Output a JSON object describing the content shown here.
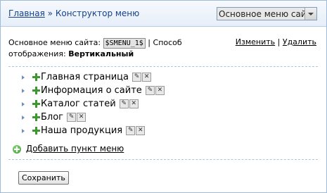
{
  "header": {
    "breadcrumb_home": "Главная",
    "breadcrumb_sep": "»",
    "breadcrumb_current": "Конструктор меню",
    "menu_select_value": "Основное меню сайта"
  },
  "info": {
    "menu_label": "Основное меню сайта:",
    "code": "$SMENU_1$",
    "sep": "|",
    "mode_label": "Способ отображения:",
    "mode_value": "Вертикальный"
  },
  "actions": {
    "edit": "Изменить",
    "sep": "|",
    "delete": "Удалить"
  },
  "tree": [
    {
      "label": "Главная страница"
    },
    {
      "label": "Информация о сайте"
    },
    {
      "label": "Каталог статей"
    },
    {
      "label": "Блог"
    },
    {
      "label": "Наша продукция"
    }
  ],
  "add_item": "Добавить пункт меню",
  "save_button": "Сохранить",
  "colors": {
    "accent": "#15428b",
    "border": "#9fbbdb",
    "plus": "#3a9a2e"
  }
}
